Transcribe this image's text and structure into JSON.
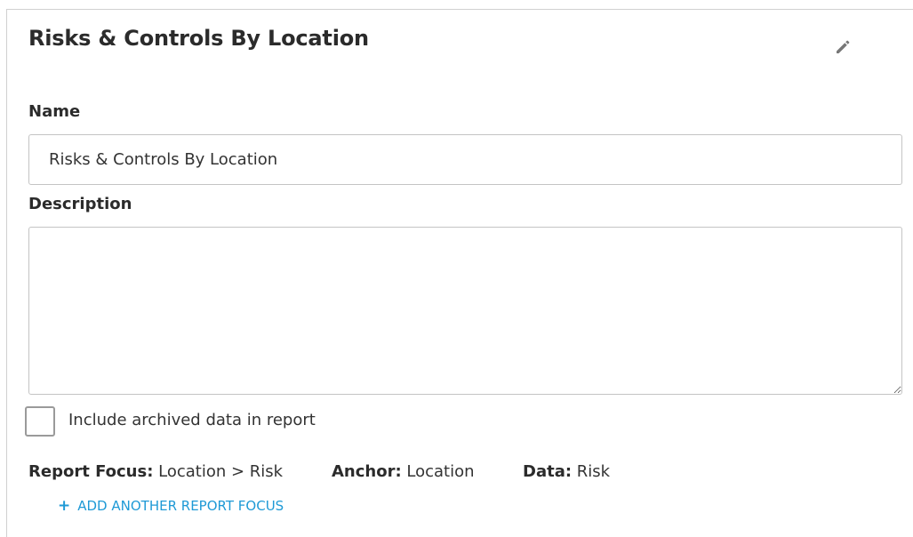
{
  "panel": {
    "title": "Risks & Controls By Location"
  },
  "icons": {
    "edit": "pencil-icon",
    "add": "plus-icon"
  },
  "form": {
    "name_label": "Name",
    "name_value": "Risks & Controls By Location",
    "description_label": "Description",
    "description_value": "",
    "archived_checkbox_label": "Include archived data in report",
    "archived_checked": false
  },
  "report": {
    "focus_key": "Report Focus:",
    "focus_value": "Location > Risk",
    "anchor_key": "Anchor:",
    "anchor_value": "Location",
    "data_key": "Data:",
    "data_value": "Risk",
    "add_focus_label": "ADD ANOTHER REPORT FOCUS"
  },
  "colors": {
    "accent": "#1f9ad6",
    "border": "#c4c4c4",
    "text": "#333333",
    "icon": "#777777"
  }
}
